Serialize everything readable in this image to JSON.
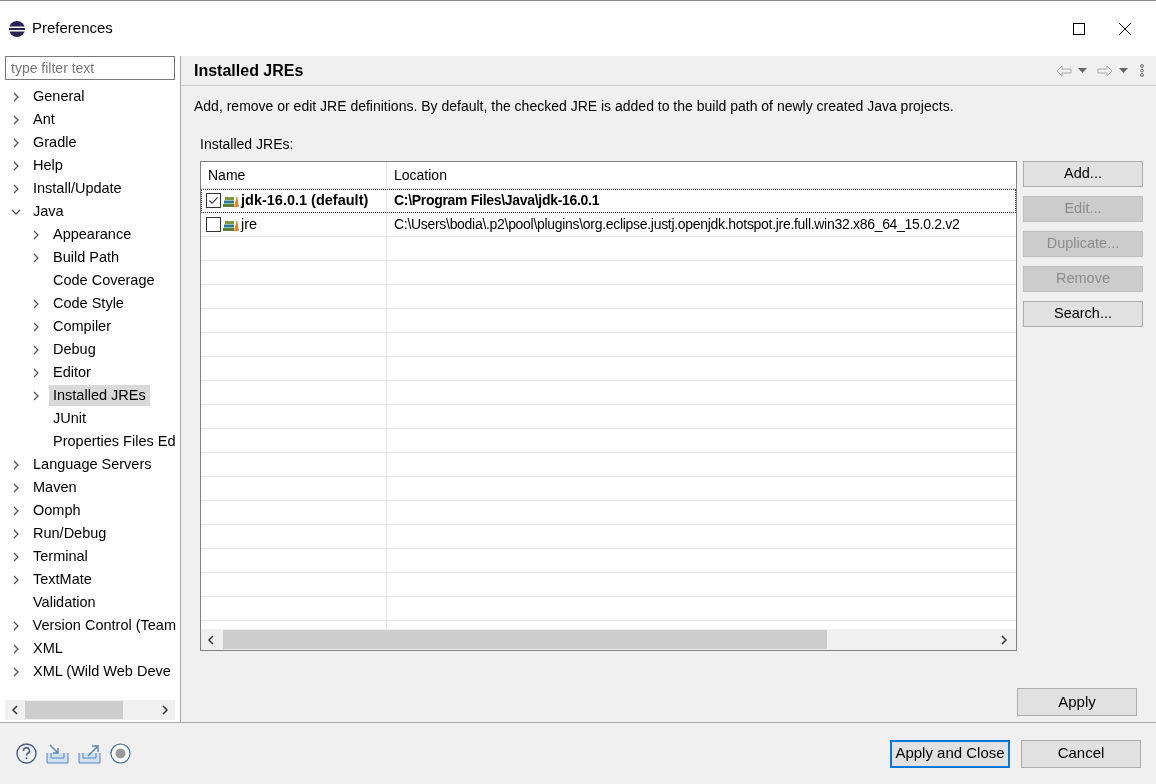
{
  "window": {
    "title": "Preferences"
  },
  "filter": {
    "placeholder": "type filter text"
  },
  "tree": [
    {
      "label": "General",
      "expanded": false,
      "selected": false
    },
    {
      "label": "Ant",
      "expanded": false,
      "selected": false
    },
    {
      "label": "Gradle",
      "expanded": false,
      "selected": false
    },
    {
      "label": "Help",
      "expanded": false,
      "selected": false
    },
    {
      "label": "Install/Update",
      "expanded": false,
      "selected": false
    },
    {
      "label": "Java",
      "expanded": true,
      "selected": false,
      "children": [
        {
          "label": "Appearance",
          "expanded": false,
          "selected": false
        },
        {
          "label": "Build Path",
          "expanded": false,
          "selected": false
        },
        {
          "label": "Code Coverage",
          "selected": false
        },
        {
          "label": "Code Style",
          "expanded": false,
          "selected": false
        },
        {
          "label": "Compiler",
          "expanded": false,
          "selected": false
        },
        {
          "label": "Debug",
          "expanded": false,
          "selected": false
        },
        {
          "label": "Editor",
          "expanded": false,
          "selected": false
        },
        {
          "label": "Installed JREs",
          "expanded": false,
          "selected": true
        },
        {
          "label": "JUnit",
          "selected": false
        },
        {
          "label": "Properties Files Ed",
          "selected": false
        }
      ]
    },
    {
      "label": "Language Servers",
      "expanded": false,
      "selected": false
    },
    {
      "label": "Maven",
      "expanded": false,
      "selected": false
    },
    {
      "label": "Oomph",
      "expanded": false,
      "selected": false
    },
    {
      "label": "Run/Debug",
      "expanded": false,
      "selected": false
    },
    {
      "label": "Terminal",
      "expanded": false,
      "selected": false
    },
    {
      "label": "TextMate",
      "expanded": false,
      "selected": false
    },
    {
      "label": "Validation",
      "selected": false
    },
    {
      "label": "Version Control (Team",
      "expanded": false,
      "selected": false
    },
    {
      "label": "XML",
      "expanded": false,
      "selected": false
    },
    {
      "label": "XML (Wild Web Deve",
      "expanded": false,
      "selected": false
    }
  ],
  "page": {
    "title": "Installed JREs",
    "description": "Add, remove or edit JRE definitions. By default, the checked JRE is added to the build path of newly created Java projects.",
    "table_label": "Installed JREs:"
  },
  "table": {
    "columns": [
      "Name",
      "Location"
    ],
    "rows": [
      {
        "name": "jdk-16.0.1 (default)",
        "location": "C:\\Program Files\\Java\\jdk-16.0.1",
        "checked": true,
        "selected": true
      },
      {
        "name": "jre",
        "location": "C:\\Users\\bodia\\.p2\\pool\\plugins\\org.eclipse.justj.openjdk.hotspot.jre.full.win32.x86_64_15.0.2.v2",
        "checked": false,
        "selected": false
      }
    ]
  },
  "side_buttons": [
    {
      "label": "Add...",
      "disabled": false
    },
    {
      "label": "Edit...",
      "disabled": true
    },
    {
      "label": "Duplicate...",
      "disabled": true
    },
    {
      "label": "Remove",
      "disabled": true
    },
    {
      "label": "Search...",
      "disabled": false
    }
  ],
  "apply_button": "Apply",
  "footer_buttons": [
    {
      "label": "Apply and Close",
      "kind": "default"
    },
    {
      "label": "Cancel",
      "kind": "normal"
    }
  ]
}
